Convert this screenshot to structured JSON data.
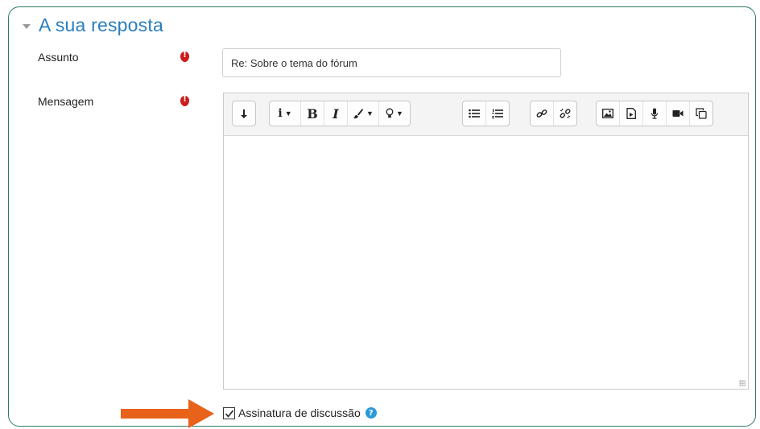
{
  "section": {
    "title": "A sua resposta",
    "collapse_icon": "chevron-down-icon"
  },
  "fields": {
    "subject": {
      "label": "Assunto",
      "value": "Re: Sobre o tema do fórum",
      "required": true
    },
    "message": {
      "label": "Mensagem",
      "value": "",
      "required": true
    }
  },
  "toolbar": {
    "icons": [
      "toggle-toolbar-icon",
      "paragraph-style-icon",
      "bold-icon",
      "italic-icon",
      "brush-icon",
      "lightbulb-icon",
      "bulleted-list-icon",
      "numbered-list-icon",
      "link-icon",
      "unlink-icon",
      "image-icon",
      "media-file-icon",
      "microphone-icon",
      "video-icon",
      "copy-icon"
    ],
    "bold_label": "B",
    "italic_label": "I",
    "style_label": "i"
  },
  "discussion_signature": {
    "label": "Assinatura de discussão",
    "checked": true
  },
  "colors": {
    "accent": "#2a7ec0",
    "required": "#cc1c1c",
    "arrow": "#e8621a",
    "frame": "#2f7a63"
  }
}
